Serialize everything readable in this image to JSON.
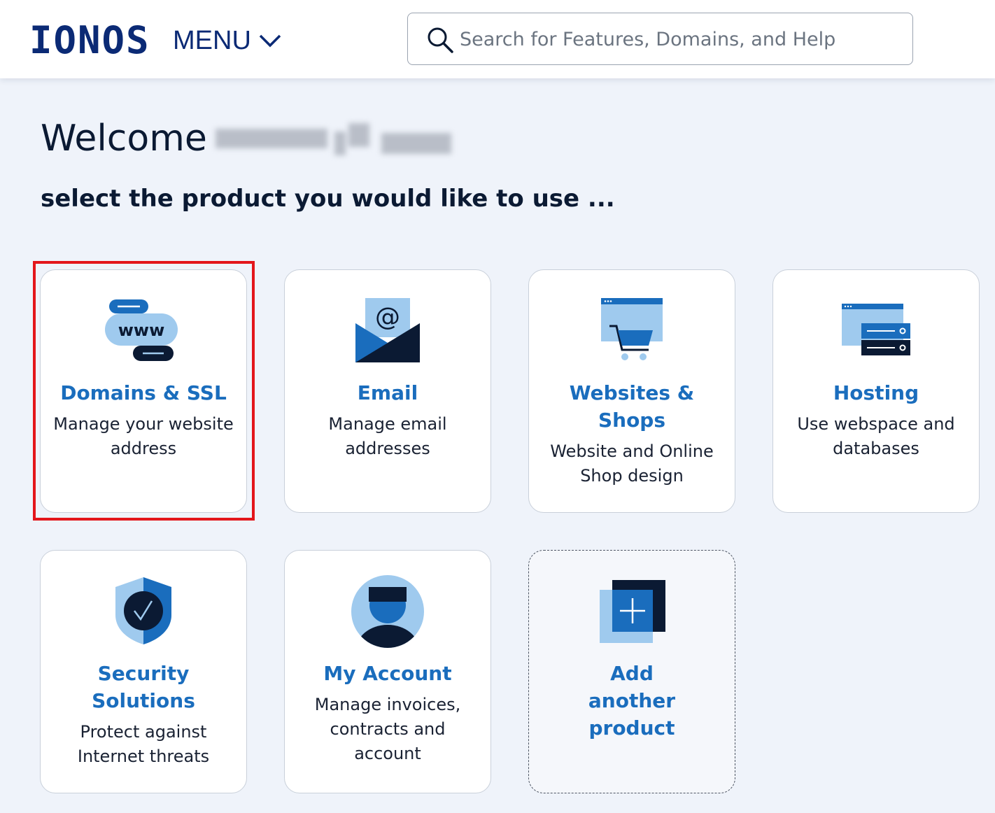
{
  "header": {
    "logo": "IONOS",
    "menu_label": "MENU",
    "search_placeholder": "Search for Features, Domains, and Help"
  },
  "welcome": {
    "greeting": "Welcome",
    "subtitle": "select the product you would like to use ..."
  },
  "products": [
    {
      "title": "Domains & SSL",
      "desc": "Manage your website address",
      "icon": "www-icon"
    },
    {
      "title": "Email",
      "desc": "Manage email addresses",
      "icon": "email-envelope-icon"
    },
    {
      "title": "Websites & Shops",
      "desc": "Website and Online Shop design",
      "icon": "shopping-cart-icon"
    },
    {
      "title": "Hosting",
      "desc": "Use webspace and databases",
      "icon": "server-icon"
    },
    {
      "title": "Security Solutions",
      "desc": "Protect against Internet threats",
      "icon": "shield-check-icon"
    },
    {
      "title": "My Account",
      "desc": "Manage invoices, contracts and account",
      "icon": "user-avatar-icon"
    },
    {
      "title": "Add another product",
      "desc": "",
      "icon": "add-product-icon"
    }
  ],
  "colors": {
    "brand": "#0b2a75",
    "accent": "#1a6dbd",
    "light_blue": "#9fcaee",
    "highlight_border": "#e3161b"
  }
}
